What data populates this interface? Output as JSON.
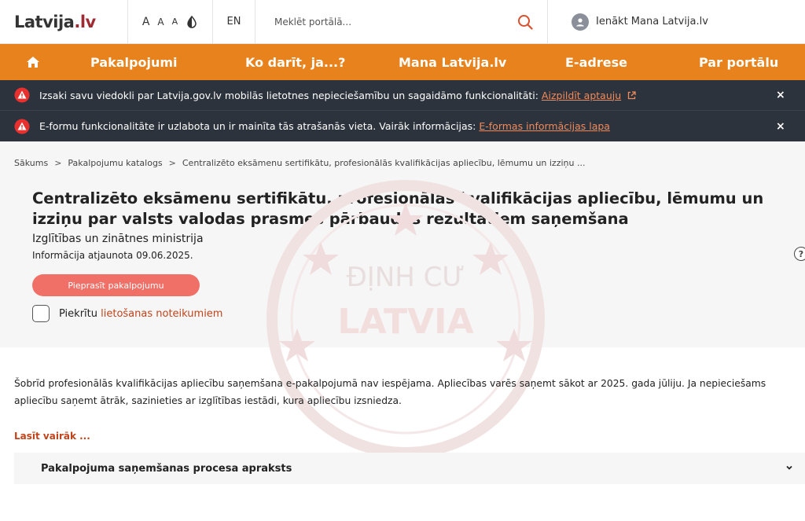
{
  "header": {
    "logo_main": "Latvija",
    "logo_accent": ".lv",
    "font_sizes": [
      "A",
      "A",
      "A"
    ],
    "language": "EN",
    "search_placeholder": "Meklēt portālā...",
    "login_label": "Ienākt Mana Latvija.lv"
  },
  "nav": {
    "items": [
      "Pakalpojumi",
      "Ko darīt, ja...?",
      "Mana Latvija.lv",
      "E-adrese",
      "Par portālu"
    ]
  },
  "alerts": [
    {
      "text": "Izsaki savu viedokli par Latvija.gov.lv mobilās lietotnes nepieciešamību un sagaidāmo funkcionalitāti: ",
      "link": "Aizpildīt aptauju",
      "close": "×"
    },
    {
      "text": "E-formu funkcionalitāte ir uzlabota un ir mainīta tās atrašanās vieta. Vairāk informācijas: ",
      "link": "E-formas informācijas lapa",
      "close": "×"
    }
  ],
  "breadcrumb": {
    "items": [
      "Sākums",
      "Pakalpojumu katalogs",
      "Centralizēto eksāmenu sertifikātu, profesionālās kvalifikācijas apliecību, lēmumu un izziņu ..."
    ],
    "separator": ">"
  },
  "service": {
    "title": "Centralizēto eksāmenu sertifikātu, profesionālās kvalifikācijas apliecību, lēmumu un izziņu par valsts valodas prasmes pārbaudes rezultātiem saņemšana",
    "ministry": "Izglītības un zinātnes ministrija",
    "updated": "Informācija atjaunota 09.06.2025.",
    "request_button": "Pieprasīt pakalpojumu",
    "agree_prefix": "Piekrītu",
    "agree_link": "lietošanas noteikumiem",
    "help": "?"
  },
  "content": {
    "description": "Šobrīd profesionālās kvalifikācijas apliecību saņemšana e-pakalpojumā nav iespējama. Apliecības varēs saņemt sākot ar 2025. gada jūliju. Ja nepieciešams apliecību saņemt ātrāk, sazinieties ar izglītības iestādi, kura apliecību izsniedza.",
    "read_more": "Lasīt vairāk ...",
    "accordion_title": "Pakalpojuma saņemšanas procesa apraksts"
  },
  "watermark": {
    "line1": "ĐỊNH CƯ",
    "line2": "LATVIA"
  },
  "colors": {
    "nav_orange": "#e8821c",
    "alert_dark": "#2d333d",
    "link_orange": "#f08a5a",
    "button_red": "#f07068",
    "logo_accent": "#9e2b33"
  }
}
